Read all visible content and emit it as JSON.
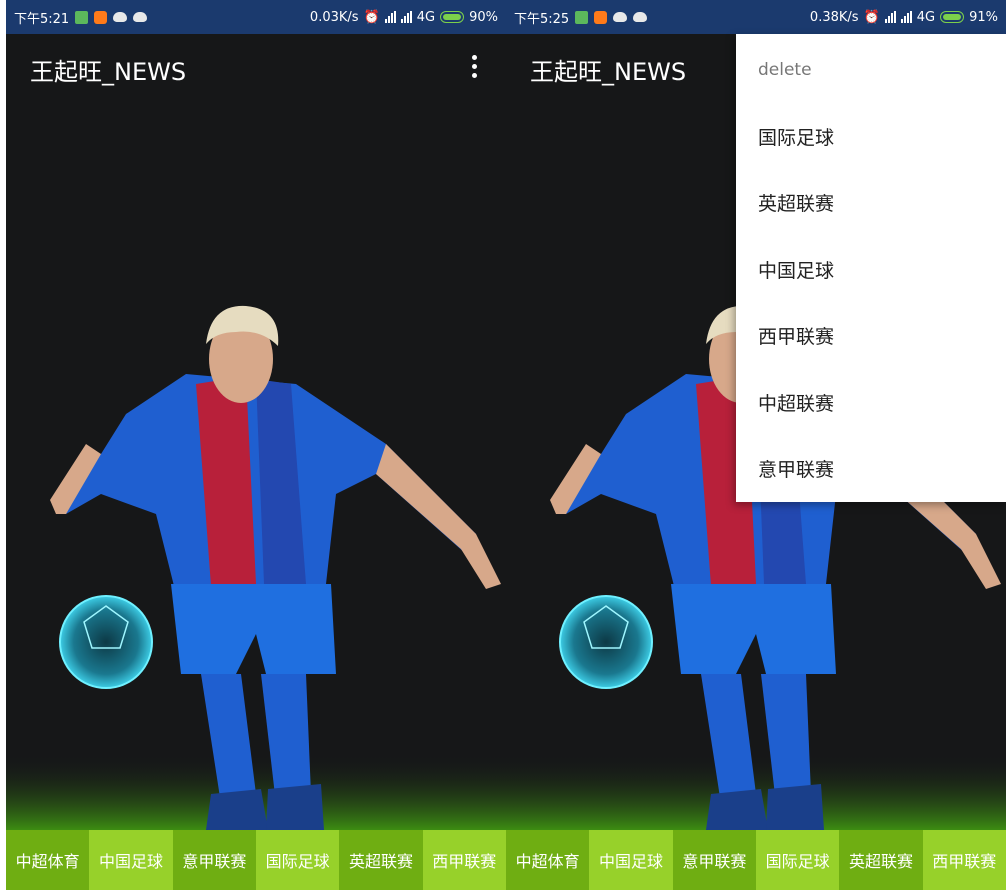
{
  "left_screen": {
    "status": {
      "time": "下午5:21",
      "network": "0.03K/s",
      "network_type": "4G",
      "battery": "90%"
    },
    "toolbar": {
      "title": "王起旺_NEWS"
    }
  },
  "right_screen": {
    "status": {
      "time": "下午5:25",
      "network": "0.38K/s",
      "network_type": "4G",
      "battery": "91%"
    },
    "toolbar": {
      "title": "王起旺_NEWS"
    },
    "overflow_menu": {
      "items": [
        "delete",
        "国际足球",
        "英超联赛",
        "中国足球",
        "西甲联赛",
        "中超联赛",
        "意甲联赛"
      ]
    }
  },
  "tabs": [
    "中超体育",
    "中国足球",
    "意甲联赛",
    "国际足球",
    "英超联赛",
    "西甲联赛"
  ],
  "colors": {
    "status_bar": "#1b3a6e",
    "background": "#161718",
    "tab_dark": "#6fae12",
    "tab_light": "#97d12a",
    "jersey_blue": "#1f5fd0",
    "jersey_red": "#b8203a",
    "ball_glow": "#3fd6f0",
    "grass": "#3c8d12"
  },
  "icons": {
    "menu": "overflow-vertical-dots-icon",
    "battery": "battery-charging-icon",
    "signal": "signal-bars-icon",
    "alarm": "alarm-off-icon"
  }
}
